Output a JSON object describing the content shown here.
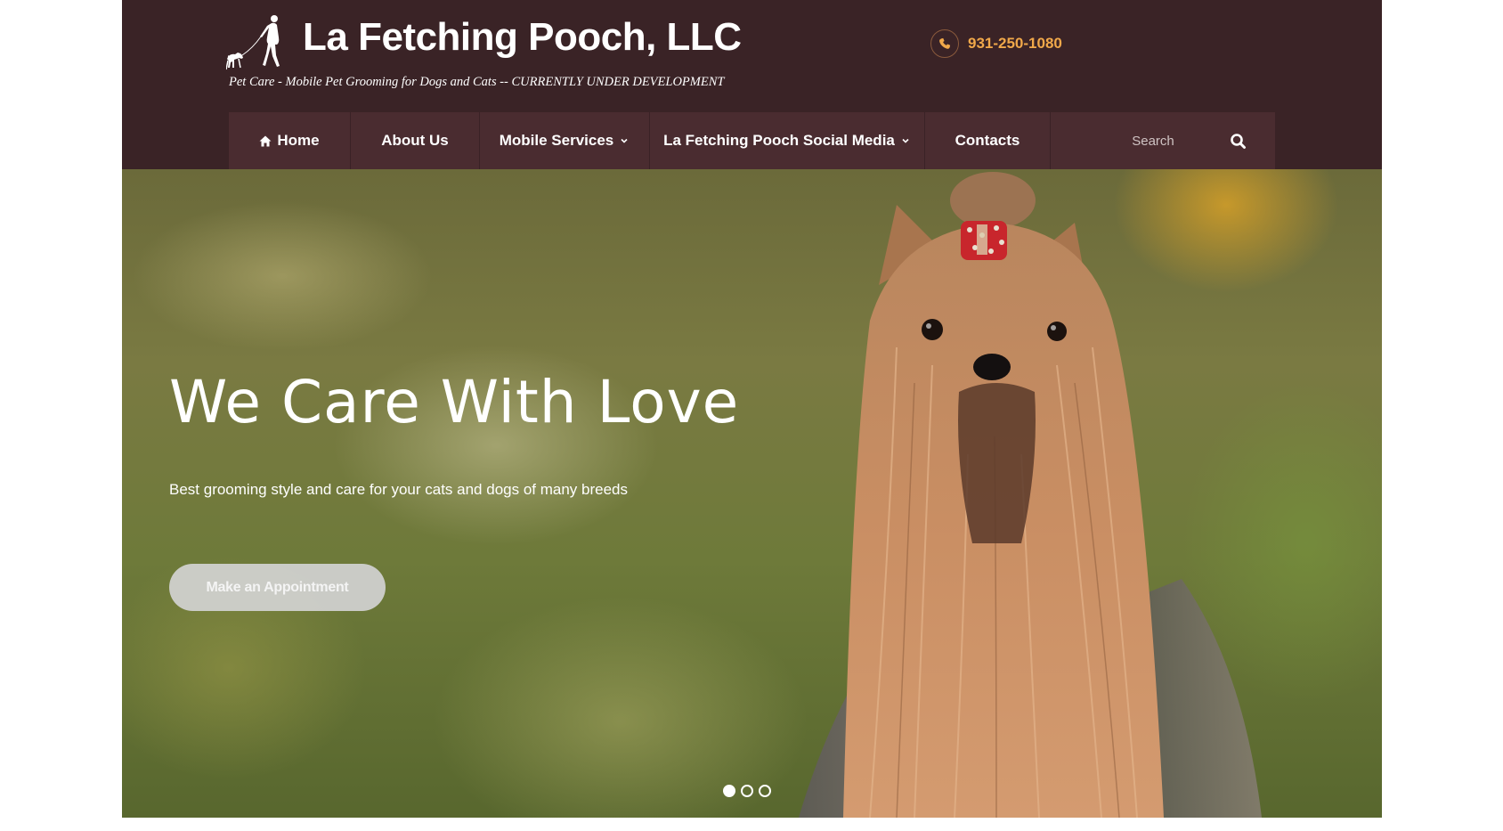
{
  "header": {
    "site_title": "La Fetching Pooch, LLC",
    "tagline": "Pet Care - Mobile Pet Grooming for Dogs and Cats -- CURRENTLY UNDER DEVELOPMENT",
    "phone": "931-250-1080",
    "logo_icon": "woman-walking-dog-logo"
  },
  "nav": {
    "items": [
      {
        "label": "Home",
        "icon": "home-icon"
      },
      {
        "label": "About Us"
      },
      {
        "label": "Mobile Services",
        "has_dropdown": true
      },
      {
        "label": "La Fetching Pooch Social Media",
        "has_dropdown": true
      },
      {
        "label": "Contacts"
      }
    ],
    "search_placeholder": "Search"
  },
  "hero": {
    "title": "We Care With Love",
    "subtitle": "Best grooming style and care for your cats and dogs of many breeds",
    "cta_label": "Make an Appointment",
    "slides_total": 3,
    "active_slide": 1
  },
  "colors": {
    "header_bg": "#3a2326",
    "nav_bg": "#4a2c30",
    "phone_accent": "#f0a84a"
  }
}
